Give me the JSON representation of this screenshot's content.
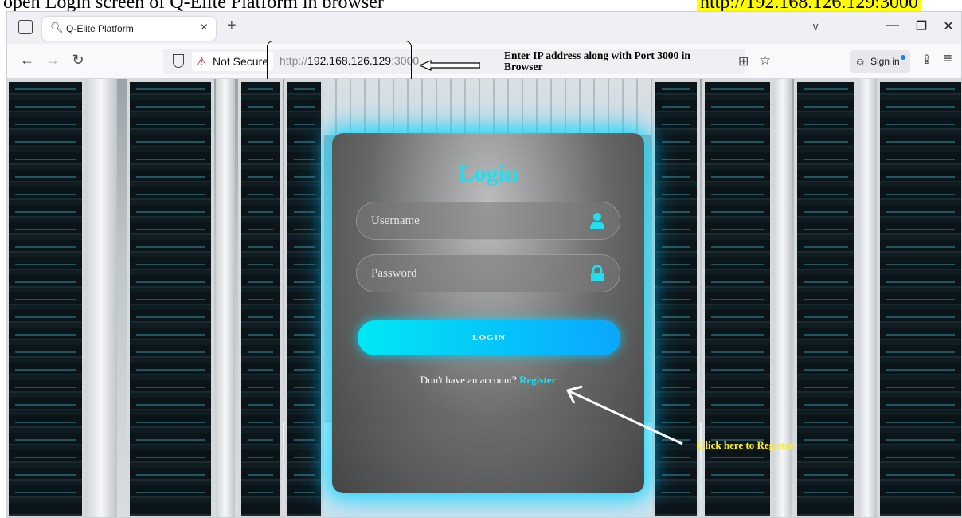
{
  "doc_caption": {
    "text": "open Login screen of Q-Elite Platform in browser",
    "highlight": "http://192.168.126.129:3000"
  },
  "browser": {
    "tab": {
      "title": "Q-Elite Platform",
      "close": "×"
    },
    "new_tab": "+",
    "urlbar": {
      "security_label": "Not Secure",
      "url_scheme": "http://",
      "url_host": "192.168.126.129",
      "url_port": ":3000"
    },
    "signin_label": "Sign in",
    "annotation": "Enter IP address along with Port 3000 in Browser"
  },
  "login": {
    "title": "Login",
    "username_placeholder": "Username",
    "password_placeholder": "Password",
    "button_label": "LOGIN",
    "prompt": "Don't have an account?",
    "register_link": "Register"
  },
  "callout": "Click here to Register",
  "colors": {
    "accent": "#22dff0",
    "button_start": "#00e8f4",
    "button_end": "#0aa6ff",
    "callout": "#ffee22",
    "caption_highlight": "#ffff00"
  }
}
